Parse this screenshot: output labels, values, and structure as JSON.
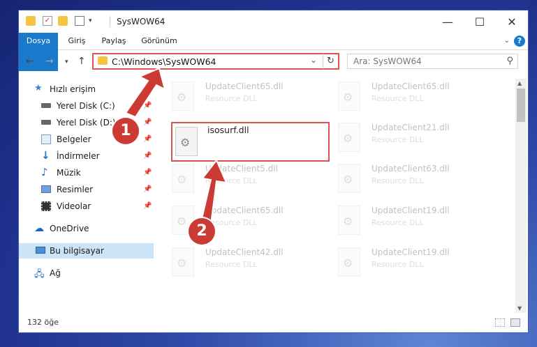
{
  "window": {
    "title": "SysWOW64",
    "controls": {
      "minimize": "—",
      "maximize": "☐",
      "close": "✕"
    }
  },
  "ribbon": {
    "tabs": [
      "Dosya",
      "Giriş",
      "Paylaş",
      "Görünüm"
    ],
    "help": "?"
  },
  "nav": {
    "address": "C:\\Windows\\SysWOW64",
    "search_placeholder": "Ara: SysWOW64"
  },
  "sidebar": {
    "items": [
      {
        "label": "Hızlı erişim",
        "icon": "star-icon"
      },
      {
        "label": "Yerel Disk (C:)",
        "icon": "drive-icon",
        "pinned": true
      },
      {
        "label": "Yerel Disk (D:)",
        "icon": "drive-icon",
        "pinned": true
      },
      {
        "label": "Belgeler",
        "icon": "documents-icon",
        "pinned": true
      },
      {
        "label": "İndirmeler",
        "icon": "downloads-icon",
        "pinned": true
      },
      {
        "label": "Müzik",
        "icon": "music-icon",
        "pinned": true
      },
      {
        "label": "Resimler",
        "icon": "pictures-icon",
        "pinned": true
      },
      {
        "label": "Videolar",
        "icon": "videos-icon",
        "pinned": true
      },
      {
        "label": "OneDrive",
        "icon": "cloud-icon"
      },
      {
        "label": "Bu bilgisayar",
        "icon": "computer-icon",
        "selected": true
      },
      {
        "label": "Ağ",
        "icon": "network-icon"
      }
    ]
  },
  "files": {
    "left": [
      {
        "name": "UpdateClient65.dll",
        "type": "Resource DLL"
      },
      {
        "name": "isosurf.dll",
        "type": ""
      },
      {
        "name": "UpdateClient5.dll",
        "type": "Resource DLL"
      },
      {
        "name": "UpdateClient65.dll",
        "type": "Resource DLL"
      },
      {
        "name": "UpdateClient42.dll",
        "type": "Resource DLL"
      }
    ],
    "right": [
      {
        "name": "UpdateClient65.dll",
        "type": "Resource DLL"
      },
      {
        "name": "UpdateClient21.dll",
        "type": "Resource DLL"
      },
      {
        "name": "UpdateClient63.dll",
        "type": "Resource DLL"
      },
      {
        "name": "UpdateClient19.dll",
        "type": "Resource DLL"
      },
      {
        "name": "UpdateClient19.dll",
        "type": "Resource DLL"
      }
    ]
  },
  "status": {
    "count": "132 öğe"
  },
  "callouts": {
    "one": "1",
    "two": "2"
  },
  "colors": {
    "accent": "#1979ca",
    "highlight": "#d9534f",
    "selected": "#cce4f7"
  }
}
